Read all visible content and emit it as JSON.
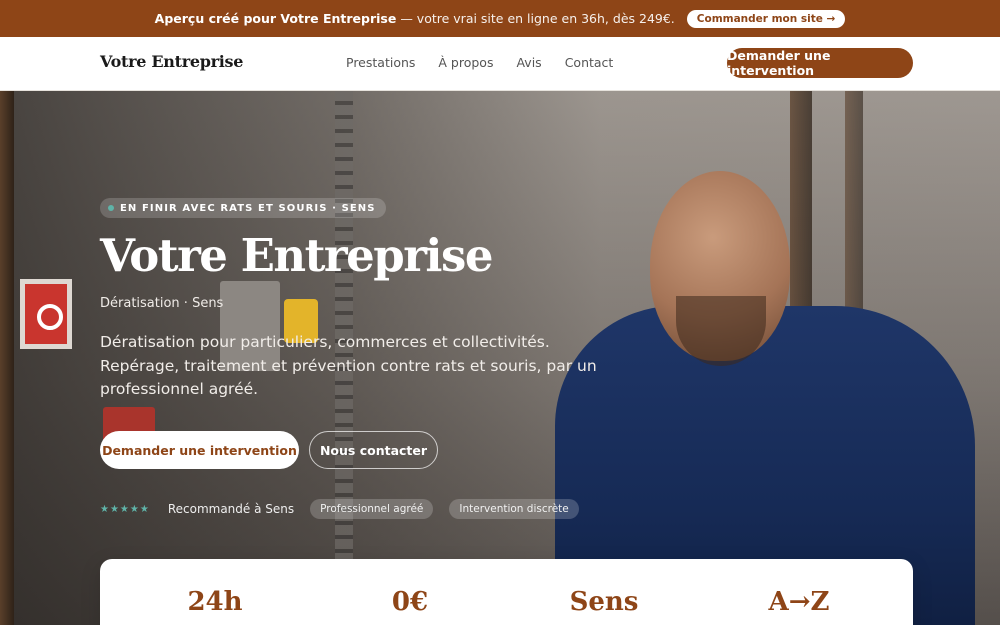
{
  "promo": {
    "bold": "Aperçu créé pour Votre Entreprise",
    "rest": "— votre vrai site en ligne en 36h, dès 249€.",
    "button": "Commander mon site →"
  },
  "header": {
    "brand": "Votre Entreprise",
    "nav": [
      "Prestations",
      "À propos",
      "Avis",
      "Contact"
    ],
    "cta": "Demander une intervention"
  },
  "hero": {
    "tag": "EN FINIR AVEC RATS ET SOURIS · SENS",
    "title": "Votre Entreprise",
    "subtitle": "Dératisation · Sens",
    "description": "Dératisation pour particuliers, commerces et collectivités. Repérage, traitement et prévention contre rats et souris, par un professionnel agréé.",
    "primary_button": "Demander une intervention",
    "secondary_button": "Nous contacter",
    "stars": "★★★★★",
    "recommend": "Recommandé à Sens",
    "pills": [
      "Professionnel agréé",
      "Intervention discrète"
    ]
  },
  "stats": [
    "24h",
    "0€",
    "Sens",
    "A→Z"
  ],
  "colors": {
    "accent": "#8e4517",
    "star": "#5fb3a8"
  }
}
